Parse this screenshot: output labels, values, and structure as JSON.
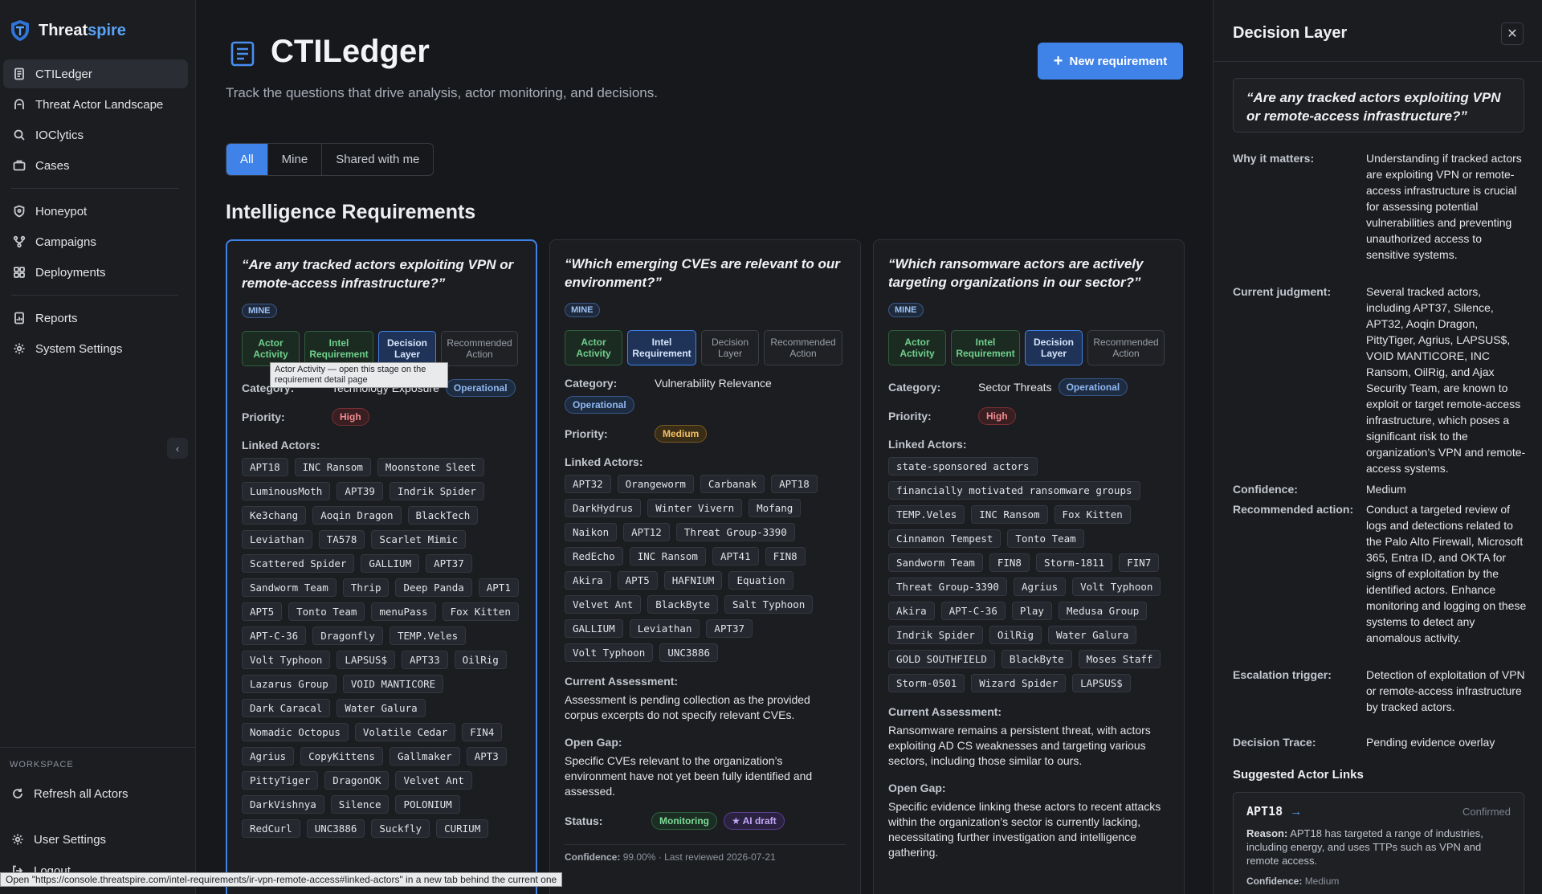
{
  "brand": {
    "name_main": "Threat",
    "name_accent": "spire"
  },
  "sidebar": {
    "items": [
      {
        "label": "CTILedger",
        "icon": "document-icon"
      },
      {
        "label": "Threat Actor Landscape",
        "icon": "hood-icon"
      },
      {
        "label": "IOClytics",
        "icon": "search-icon"
      },
      {
        "label": "Cases",
        "icon": "briefcase-icon"
      },
      {
        "label": "Honeypot",
        "icon": "shield-icon"
      },
      {
        "label": "Campaigns",
        "icon": "branch-icon"
      },
      {
        "label": "Deployments",
        "icon": "grid-icon"
      },
      {
        "label": "Reports",
        "icon": "report-icon"
      },
      {
        "label": "System Settings",
        "icon": "gear-icon"
      }
    ],
    "collapse_glyph": "‹",
    "workspace_label": "WORKSPACE",
    "refresh_label": "Refresh all Actors",
    "user_settings_label": "User Settings",
    "logout_label": "Logout"
  },
  "main": {
    "title": "CTILedger",
    "subtitle": "Track the questions that drive analysis, actor monitoring, and decisions.",
    "new_button": "New requirement",
    "new_button_glyph": "+",
    "filters": [
      "All",
      "Mine",
      "Shared with me"
    ],
    "section_title": "Intelligence Requirements"
  },
  "labels": {
    "category": "Category:",
    "priority": "Priority:",
    "linked_actors": "Linked Actors:",
    "current_assessment": "Current Assessment:",
    "open_gap": "Open Gap:",
    "status": "Status:"
  },
  "stage_labels": [
    "Actor Activity",
    "Intel Requirement",
    "Decision Layer",
    "Recommended Action"
  ],
  "cards": [
    {
      "question": "“Are any tracked actors exploiting VPN or remote-access infrastructure?”",
      "badge": "MINE",
      "category": "Technology Exposure",
      "category_pill": "Operational",
      "priority": "High",
      "actors": [
        "APT18",
        "INC Ransom",
        "Moonstone Sleet",
        "LuminousMoth",
        "APT39",
        "Indrik Spider",
        "Ke3chang",
        "Aoqin Dragon",
        "BlackTech",
        "Leviathan",
        "TA578",
        "Scarlet Mimic",
        "Scattered Spider",
        "GALLIUM",
        "APT37",
        "Sandworm Team",
        "Thrip",
        "Deep Panda",
        "APT1",
        "APT5",
        "Tonto Team",
        "menuPass",
        "Fox Kitten",
        "APT-C-36",
        "Dragonfly",
        "TEMP.Veles",
        "Volt Typhoon",
        "LAPSUS$",
        "APT33",
        "OilRig",
        "Lazarus Group",
        "VOID MANTICORE",
        "Dark Caracal",
        "Water Galura",
        "Nomadic Octopus",
        "Volatile Cedar",
        "FIN4",
        "Agrius",
        "CopyKittens",
        "Gallmaker",
        "APT3",
        "PittyTiger",
        "DragonOK",
        "Velvet Ant",
        "DarkVishnya",
        "Silence",
        "POLONIUM",
        "RedCurl",
        "UNC3886",
        "Suckfly",
        "CURIUM"
      ]
    },
    {
      "question": "“Which emerging CVEs are relevant to our environment?”",
      "badge": "MINE",
      "category": "Vulnerability Relevance",
      "category_pill": "Operational",
      "priority": "Medium",
      "actors": [
        "APT32",
        "Orangeworm",
        "Carbanak",
        "APT18",
        "DarkHydrus",
        "Winter Vivern",
        "Mofang",
        "Naikon",
        "APT12",
        "Threat Group-3390",
        "RedEcho",
        "INC Ransom",
        "APT41",
        "FIN8",
        "Akira",
        "APT5",
        "HAFNIUM",
        "Equation",
        "Velvet Ant",
        "BlackByte",
        "Salt Typhoon",
        "GALLIUM",
        "Leviathan",
        "APT37",
        "Volt Typhoon",
        "UNC3886"
      ],
      "assessment": "Assessment is pending collection as the provided corpus excerpts do not specify relevant CVEs.",
      "gap": "Specific CVEs relevant to the organization’s environment have not yet been fully identified and assessed.",
      "status": "Monitoring",
      "status_ai": "★ AI draft",
      "confidence_label": "Confidence:",
      "confidence_value": "99.00%",
      "last_reviewed": "· Last reviewed 2026-07-21"
    },
    {
      "question": "“Which ransomware actors are actively targeting organizations in our sector?”",
      "badge": "MINE",
      "category": "Sector Threats",
      "category_pill": "Operational",
      "priority": "High",
      "actors": [
        "state-sponsored actors",
        "financially motivated ransomware groups",
        "TEMP.Veles",
        "INC Ransom",
        "Fox Kitten",
        "Cinnamon Tempest",
        "Tonto Team",
        "Sandworm Team",
        "FIN8",
        "Storm-1811",
        "FIN7",
        "Threat Group-3390",
        "Agrius",
        "Volt Typhoon",
        "Akira",
        "APT-C-36",
        "Play",
        "Medusa Group",
        "Indrik Spider",
        "OilRig",
        "Water Galura",
        "GOLD SOUTHFIELD",
        "BlackByte",
        "Moses Staff",
        "Storm-0501",
        "Wizard Spider",
        "LAPSUS$"
      ],
      "assessment": "Ransomware remains a persistent threat, with actors exploiting AD CS weaknesses and targeting various sectors, including those similar to ours.",
      "gap": "Specific evidence linking these actors to recent attacks within the organization’s sector is currently lacking, necessitating further investigation and intelligence gathering."
    }
  ],
  "tooltip": "Actor Activity — open this stage on the requirement detail page",
  "panel": {
    "title": "Decision Layer",
    "close_glyph": "✕",
    "question": "“Are any tracked actors exploiting VPN or remote-access infrastructure?”",
    "why_label": "Why it matters:",
    "why": "Understanding if tracked actors are exploiting VPN or remote-access infrastructure is crucial for assessing potential vulnerabilities and preventing unauthorized access to sensitive systems.",
    "judgment_label": "Current judgment:",
    "judgment": "Several tracked actors, including APT37, Silence, APT32, Aoqin Dragon, PittyTiger, Agrius, LAPSUS$, VOID MANTICORE, INC Ransom, OilRig, and Ajax Security Team, are known to exploit or target remote-access infrastructure, which poses a significant risk to the organization’s VPN and remote-access systems.",
    "confidence_label": "Confidence:",
    "confidence": "Medium",
    "action_label": "Recommended action:",
    "action": "Conduct a targeted review of logs and detections related to the Palo Alto Firewall, Microsoft 365, Entra ID, and OKTA for signs of exploitation by the identified actors. Enhance monitoring and logging on these systems to detect any anomalous activity.",
    "trigger_label": "Escalation trigger:",
    "trigger": "Detection of exploitation of VPN or remote-access infrastructure by tracked actors.",
    "trace_label": "Decision Trace:",
    "trace": "Pending evidence overlay",
    "suggested_title": "Suggested Actor Links",
    "suggestion": {
      "name": "APT18",
      "arrow": "→",
      "status": "Confirmed",
      "reason_label": "Reason:",
      "reason": "APT18 has targeted a range of industries, including energy, and uses TTPs such as VPN and remote access.",
      "confidence_label": "Confidence:",
      "confidence": "Medium"
    }
  },
  "statusbar": "Open \"https://console.threatspire.com/intel-requirements/ir-vpn-remote-access#linked-actors\" in a new tab behind the current one",
  "colors": {
    "accent": "#3f82e8",
    "brand_accent": "#5aa2f5",
    "high": "#f08b8f",
    "medium": "#f2c064",
    "monitoring": "#7edb98"
  }
}
